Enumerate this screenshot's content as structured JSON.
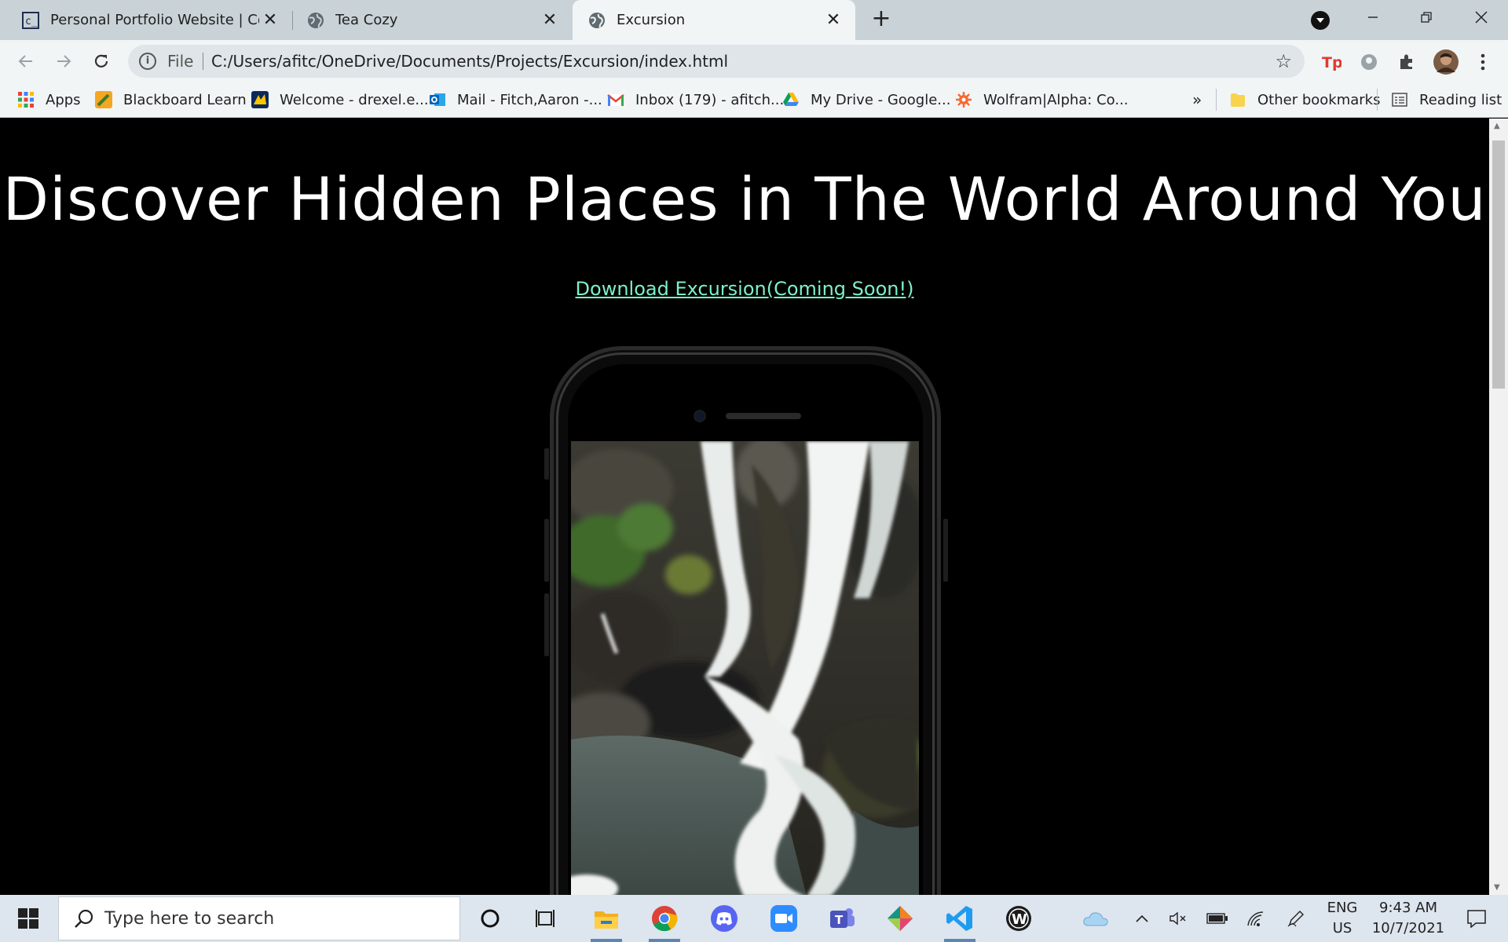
{
  "browser": {
    "tabs": [
      {
        "title": "Personal Portfolio Website | Code",
        "favicon": "codecademy-icon",
        "active": false
      },
      {
        "title": "Tea Cozy",
        "favicon": "globe-icon",
        "active": false
      },
      {
        "title": "Excursion",
        "favicon": "globe-icon",
        "active": true
      }
    ],
    "tab_close_symbol": "✕",
    "new_tab_symbol": "+",
    "address": {
      "scheme_label": "File",
      "url": "C:/Users/afitc/OneDrive/Documents/Projects/Excursion/index.html"
    },
    "bookmarks": [
      {
        "label": "Apps",
        "icon": "apps-grid-icon"
      },
      {
        "label": "Blackboard Learn",
        "icon": "blackboard-icon"
      },
      {
        "label": "Welcome - drexel.e...",
        "icon": "drexel-icon"
      },
      {
        "label": "Mail - Fitch,Aaron -...",
        "icon": "outlook-icon"
      },
      {
        "label": "Inbox (179) - afitch...",
        "icon": "gmail-icon"
      },
      {
        "label": "My Drive - Google...",
        "icon": "google-drive-icon"
      },
      {
        "label": "Wolfram|Alpha: Co...",
        "icon": "wolfram-icon"
      }
    ],
    "overflow_symbol": "»",
    "other_bookmarks": "Other bookmarks",
    "reading_list": "Reading list"
  },
  "page": {
    "headline": "Discover Hidden Places in The World Around You",
    "download_link": "Download Excursion(Coming Soon!)"
  },
  "taskbar": {
    "search_placeholder": "Type here to search",
    "apps": [
      "cortana-icon",
      "task-view-icon",
      "file-explorer-icon",
      "chrome-icon",
      "discord-icon",
      "zoom-icon",
      "teams-icon",
      "gitkraken-icon",
      "vscode-icon",
      "wolfram-app-icon"
    ],
    "language_line1": "ENG",
    "language_line2": "US",
    "time": "9:43 AM",
    "date": "10/7/2021"
  },
  "colors": {
    "link": "#7ef0c8",
    "page_background": "#000000",
    "tabstrip": "#c9d3d7",
    "toolbar": "#f2f5f6"
  }
}
